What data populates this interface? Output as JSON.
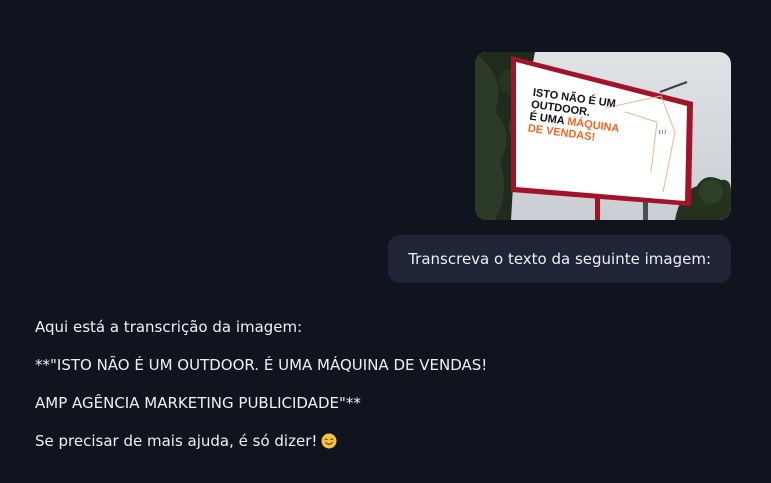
{
  "conversation": {
    "user_message": "Transcreva o texto da seguinte imagem:",
    "attachment": {
      "billboard_line1": "ISTO NÃO É UM",
      "billboard_line2": "OUTDOOR.",
      "billboard_line3a": "É UMA ",
      "billboard_line3b": "MÁQUINA",
      "billboard_line4": "DE VENDAS!"
    },
    "assistant_intro": "Aqui está a transcrição da imagem:",
    "assistant_line1": "**\"ISTO NÃO É UM OUTDOOR. É UMA MÁQUINA DE VENDAS!",
    "assistant_line2": "AMP AGÊNCIA MARKETING PUBLICIDADE\"**",
    "assistant_outro": "Se precisar de mais ajuda, é só dizer!",
    "emoji_icon": "smiling-face-emoji-icon"
  },
  "colors": {
    "background": "#10141f",
    "user_bubble": "#1f2436",
    "text": "#eef0f6",
    "billboard_accent": "#f26522",
    "billboard_frame": "#a4122a"
  }
}
